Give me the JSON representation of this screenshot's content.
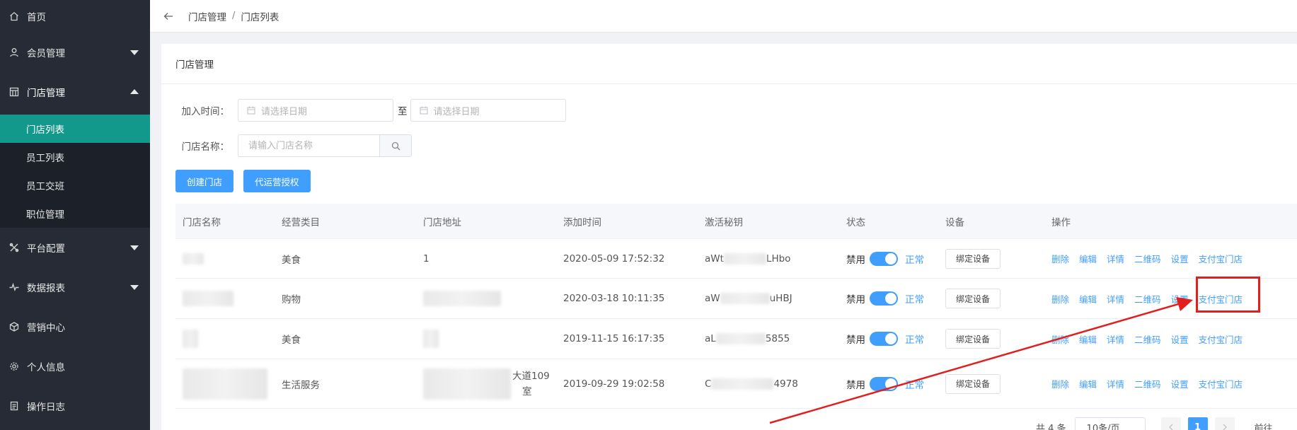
{
  "sidebar": {
    "items": [
      {
        "label": "首页",
        "icon": "home-icon"
      },
      {
        "label": "会员管理",
        "icon": "user-icon",
        "expanded": false
      },
      {
        "label": "门店管理",
        "icon": "store-icon",
        "expanded": true
      },
      {
        "label": "平台配置",
        "icon": "tools-icon",
        "expanded": false
      },
      {
        "label": "数据报表",
        "icon": "pulse-icon",
        "expanded": false
      },
      {
        "label": "营销中心",
        "icon": "cube-icon"
      },
      {
        "label": "个人信息",
        "icon": "gear-icon"
      },
      {
        "label": "操作日志",
        "icon": "log-icon"
      }
    ],
    "store_sub": [
      "门店列表",
      "员工列表",
      "员工交班",
      "职位管理"
    ],
    "active_sub": "门店列表"
  },
  "breadcrumb": {
    "parent": "门店管理",
    "separator": "/",
    "current": "门店列表"
  },
  "card": {
    "title": "门店管理"
  },
  "filters": {
    "join_time_label": "加入时间：",
    "date_start_placeholder": "请选择日期",
    "to_label": "至",
    "date_end_placeholder": "请选择日期",
    "store_name_label": "门店名称：",
    "store_name_placeholder": "请输入门店名称"
  },
  "actions": {
    "create_store": "创建门店",
    "delegate_auth": "代运营授权"
  },
  "table": {
    "headers": [
      "门店名称",
      "经营类目",
      "门店地址",
      "添加时间",
      "激活秘钥",
      "状态",
      "设备",
      "操作"
    ],
    "rows": [
      {
        "category": "美食",
        "address_visible": "1",
        "added": "2020-05-09 17:52:32",
        "key_prefix": "aWt",
        "key_suffix": "LHbo"
      },
      {
        "category": "购物",
        "address_visible": "",
        "added": "2020-03-18 10:11:35",
        "key_prefix": "aW",
        "key_suffix": "uHBJ"
      },
      {
        "category": "美食",
        "address_visible": "",
        "added": "2019-11-15 16:17:35",
        "key_prefix": "aL",
        "key_suffix": "5855"
      },
      {
        "category": "生活服务",
        "address_visible": "大道109",
        "address_line2": "室",
        "added": "2019-09-29 19:02:58",
        "key_prefix": "C",
        "key_suffix": "4978"
      }
    ],
    "status_off": "禁用",
    "status_on": "正常",
    "bind_device": "绑定设备",
    "ops": [
      "删除",
      "编辑",
      "详情",
      "二维码",
      "设置",
      "支付宝门店"
    ]
  },
  "pagination": {
    "total": "共 4 条",
    "page_size": "10条/页",
    "current_page": "1",
    "goto": "前往"
  },
  "colors": {
    "sidebar_bg": "#262b35",
    "active_teal": "#13998b",
    "primary": "#409eff",
    "annotation_red": "#e21f1f"
  }
}
